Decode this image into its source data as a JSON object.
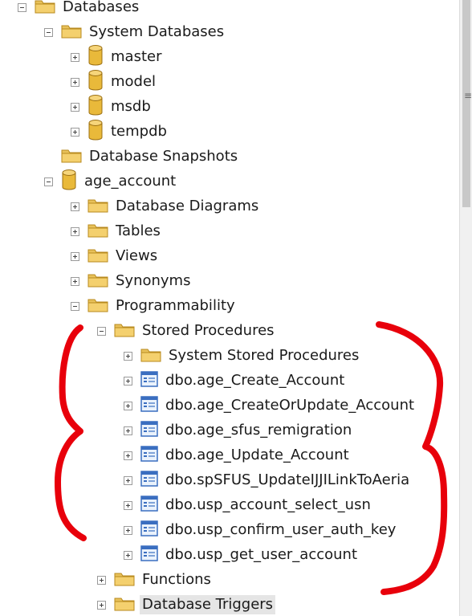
{
  "tree": {
    "nodes": [
      {
        "label": "Databases",
        "level": 0,
        "state": "expanded",
        "icon": "folder-icon"
      },
      {
        "label": "System Databases",
        "level": 1,
        "state": "expanded",
        "icon": "folder-icon"
      },
      {
        "label": "master",
        "level": 2,
        "state": "collapsed",
        "icon": "database-icon"
      },
      {
        "label": "model",
        "level": 2,
        "state": "collapsed",
        "icon": "database-icon"
      },
      {
        "label": "msdb",
        "level": 2,
        "state": "collapsed",
        "icon": "database-icon"
      },
      {
        "label": "tempdb",
        "level": 2,
        "state": "collapsed",
        "icon": "database-icon"
      },
      {
        "label": "Database Snapshots",
        "level": 1,
        "state": "none",
        "icon": "folder-icon"
      },
      {
        "label": "age_account",
        "level": 1,
        "state": "expanded",
        "icon": "database-icon"
      },
      {
        "label": "Database Diagrams",
        "level": 2,
        "state": "collapsed",
        "icon": "folder-icon"
      },
      {
        "label": "Tables",
        "level": 2,
        "state": "collapsed",
        "icon": "folder-icon"
      },
      {
        "label": "Views",
        "level": 2,
        "state": "collapsed",
        "icon": "folder-icon"
      },
      {
        "label": "Synonyms",
        "level": 2,
        "state": "collapsed",
        "icon": "folder-icon"
      },
      {
        "label": "Programmability",
        "level": 2,
        "state": "expanded",
        "icon": "folder-icon"
      },
      {
        "label": "Stored Procedures",
        "level": 3,
        "state": "expanded",
        "icon": "folder-icon"
      },
      {
        "label": "System Stored Procedures",
        "level": 4,
        "state": "collapsed",
        "icon": "folder-icon"
      },
      {
        "label": "dbo.age_Create_Account",
        "level": 4,
        "state": "collapsed",
        "icon": "stored-procedure-icon"
      },
      {
        "label": "dbo.age_CreateOrUpdate_Account",
        "level": 4,
        "state": "collapsed",
        "icon": "stored-procedure-icon"
      },
      {
        "label": "dbo.age_sfus_remigration",
        "level": 4,
        "state": "collapsed",
        "icon": "stored-procedure-icon"
      },
      {
        "label": "dbo.age_Update_Account",
        "level": 4,
        "state": "collapsed",
        "icon": "stored-procedure-icon"
      },
      {
        "label": "dbo.spSFUS_UpdateIJJILinkToAeria",
        "level": 4,
        "state": "collapsed",
        "icon": "stored-procedure-icon"
      },
      {
        "label": "dbo.usp_account_select_usn",
        "level": 4,
        "state": "collapsed",
        "icon": "stored-procedure-icon"
      },
      {
        "label": "dbo.usp_confirm_user_auth_key",
        "level": 4,
        "state": "collapsed",
        "icon": "stored-procedure-icon"
      },
      {
        "label": "dbo.usp_get_user_account",
        "level": 4,
        "state": "collapsed",
        "icon": "stored-procedure-icon"
      },
      {
        "label": "Functions",
        "level": 3,
        "state": "collapsed",
        "icon": "folder-icon"
      },
      {
        "label": "Database Triggers",
        "level": 3,
        "state": "collapsed",
        "icon": "folder-icon",
        "selected": true
      }
    ]
  },
  "colors": {
    "annotation": "#e8000b",
    "folder": "#e8c15a",
    "database": "#e9b93a",
    "procedure": "#3a6ec0"
  },
  "icons": {
    "annotation": "red-curly-brace-annotation-icon",
    "grip": "scrollbar-grip-icon"
  }
}
